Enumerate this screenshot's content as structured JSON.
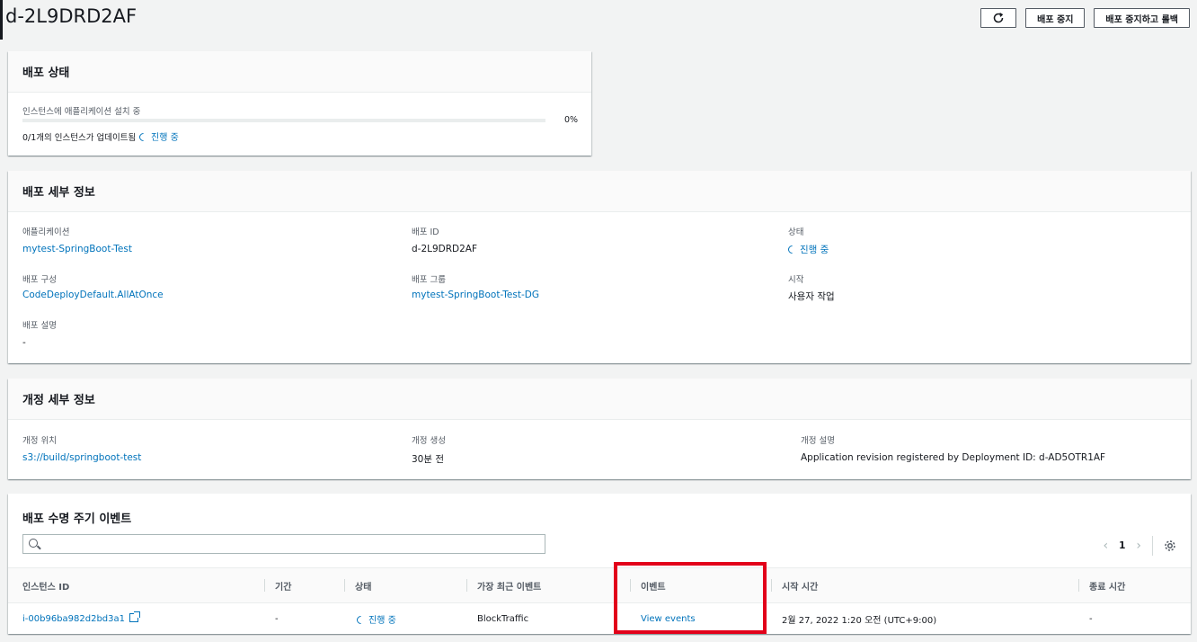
{
  "page": {
    "title": "d-2L9DRD2AF",
    "refresh_icon": "refresh-icon",
    "stop_button": "배포 중지",
    "stop_rollback_button": "배포 중지하고 롤백"
  },
  "status_panel": {
    "title": "배포 상태",
    "step_label": "인스턴스에 애플리케이션 설치 중",
    "progress_text": "0%",
    "progress_fraction": 0,
    "instances_text": "0/1개의 인스턴스가 업데이트됨",
    "status": "진행 중"
  },
  "details_panel": {
    "title": "배포 세부 정보",
    "application_label": "애플리케이션",
    "application_value": "mytest-SpringBoot-Test",
    "deployment_id_label": "배포 ID",
    "deployment_id_value": "d-2L9DRD2AF",
    "status_label": "상태",
    "status_value": "진행 중",
    "config_label": "배포 구성",
    "config_value": "CodeDeployDefault.AllAtOnce",
    "group_label": "배포 그룹",
    "group_value": "mytest-SpringBoot-Test-DG",
    "start_label": "시작",
    "start_value": "사용자 작업",
    "description_label": "배포 설명",
    "description_value": "-"
  },
  "revision_panel": {
    "title": "개정 세부 정보",
    "location_label": "개정 위치",
    "location_value": "s3://build/springboot-test",
    "created_label": "개정 생성",
    "created_value": "30분 전",
    "description_label": "개정 설명",
    "description_value": "Application revision registered by Deployment ID: d-AD5OTR1AF"
  },
  "events_panel": {
    "title": "배포 수명 주기 이벤트",
    "search_placeholder": "",
    "page_number": "1",
    "prev_icon": "chevron-left-icon",
    "next_icon": "chevron-right-icon",
    "settings_icon": "gear-icon",
    "columns": [
      "인스턴스 ID",
      "기간",
      "상태",
      "가장 최근 이벤트",
      "이벤트",
      "시작 시간",
      "종료 시간"
    ],
    "rows": [
      {
        "instance_id": "i-00b96ba982d2bd3a1",
        "duration": "-",
        "status": "진행 중",
        "latest_event": "BlockTraffic",
        "events": "View events",
        "start_time": "2월 27, 2022 1:20 오전 (UTC+9:00)",
        "end_time": "-"
      }
    ]
  },
  "colors": {
    "link": "#0073bb",
    "highlight": "#e2001a"
  }
}
